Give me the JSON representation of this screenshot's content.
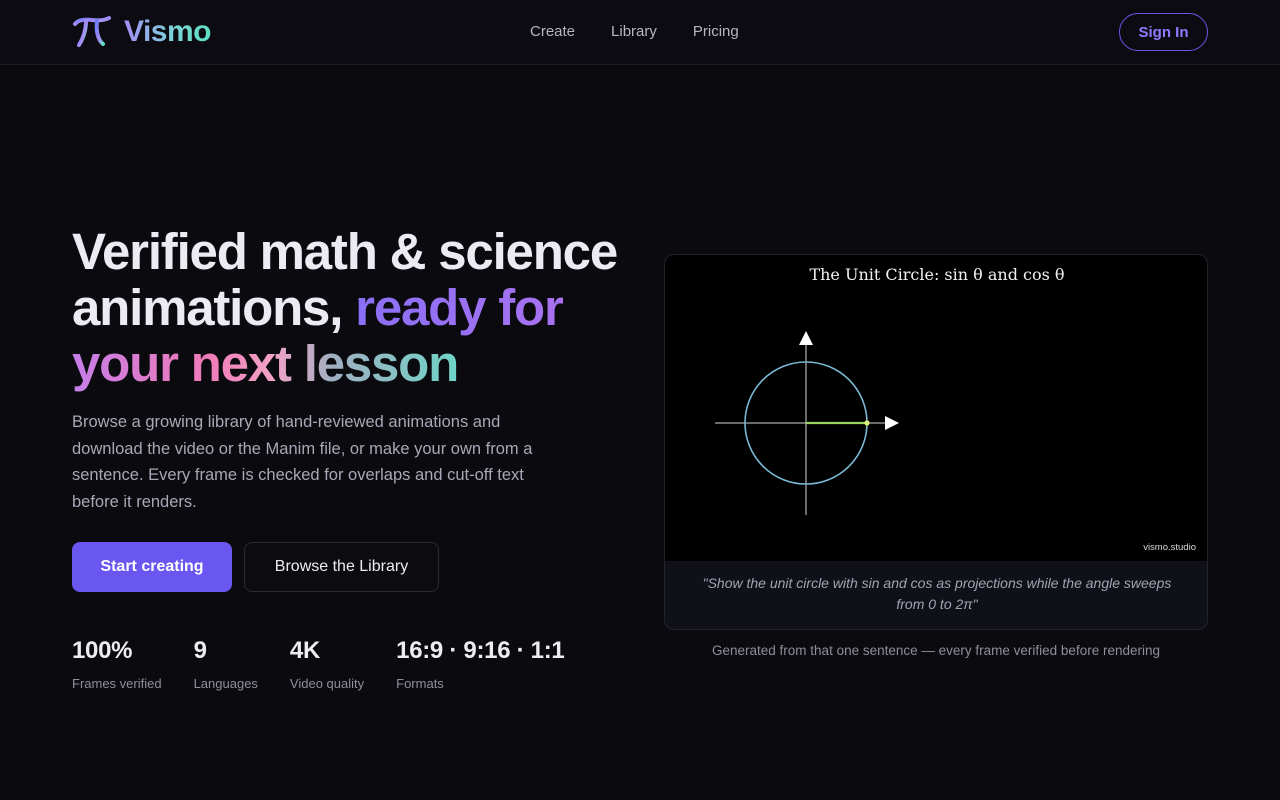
{
  "header": {
    "brand": "Vismo",
    "nav": [
      {
        "label": "Create"
      },
      {
        "label": "Library"
      },
      {
        "label": "Pricing"
      }
    ],
    "sign_in": "Sign In"
  },
  "hero": {
    "title_plain": "Verified math & science animations, ",
    "title_accent_1": "ready for",
    "title_accent_2": "your next lesson",
    "description": "Browse a growing library of hand-reviewed animations and download the video or the Manim file, or make your own from a sentence. Every frame is checked for overlaps and cut-off text before it renders.",
    "primary_cta": "Start creating",
    "secondary_cta": "Browse the Library",
    "stats": [
      {
        "value": "100%",
        "label": "Frames verified"
      },
      {
        "value": "9",
        "label": "Languages"
      },
      {
        "value": "4K",
        "label": "Video quality"
      },
      {
        "value": "16:9 · 9:16 · 1:1",
        "label": "Formats"
      }
    ]
  },
  "preview": {
    "video_title": "The Unit Circle: sin θ and cos θ",
    "watermark": "vismo.studio",
    "prompt": "\"Show the unit circle with sin and cos as projections while the angle sweeps from 0 to 2π\"",
    "caption": "Generated from that one sentence — every frame verified before rendering"
  },
  "colors": {
    "accent": "#6a56f0",
    "background": "#0a0a0f",
    "circle": "#7ab8d4",
    "radius": "#9bd45e"
  }
}
